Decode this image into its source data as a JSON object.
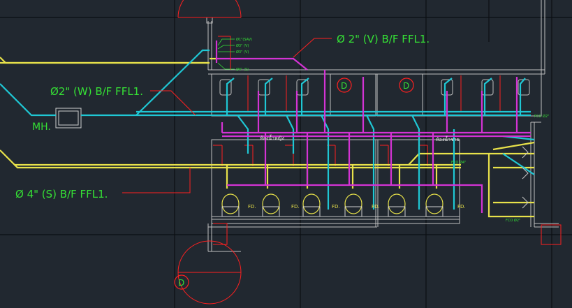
{
  "labels": {
    "vent_pipe": "Ø  2\" (V) B/F FFL1.",
    "waste_pipe": "Ø2\" (W) B/F FFL1.",
    "soil_pipe": "Ø  4\" (S) B/F FFL1.",
    "manhole": "MH.",
    "room_left": "ห้องน้ำหญิง",
    "room_right": "ห้องน้ำชาย",
    "riser_1": "Ø1\"(SAV)",
    "riser_2": "Ø3\" (V)",
    "riser_3": "Ø3\" (V)",
    "riser_4": "Ø4\" (S)",
    "fco_top": "FCO Ø2\"",
    "fco_mid": "FCO Ø4\"",
    "fco_bottom": "FCO Ø2\"",
    "drain_left": "D",
    "drain_right": "D",
    "drain_bottom": "D",
    "floor_drains": [
      "FD.",
      "FD.",
      "FD.",
      "FD.",
      "FD."
    ]
  },
  "colors": {
    "background": "#212830",
    "grid": "#0a0e12",
    "soil_pipe": "#e8e24a",
    "waste_pipe": "#1fc7d4",
    "vent_pipe": "#d433d4",
    "annotation": "#35e035",
    "wall_outline": "#c8c8c8",
    "leader_red": "#ff2020"
  }
}
